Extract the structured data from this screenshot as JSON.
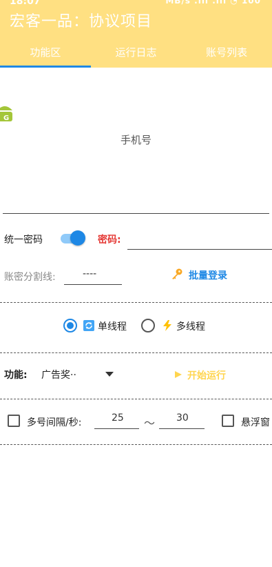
{
  "statusbar": {
    "time": "18:07",
    "icons": "MB/s  .ıll  .ıll  ◔ 100"
  },
  "app": {
    "title": "宏客一品：协议项目"
  },
  "tabs": [
    {
      "label": "功能区",
      "active": true
    },
    {
      "label": "运行日志",
      "active": false
    },
    {
      "label": "账号列表",
      "active": false
    }
  ],
  "phone": {
    "label": "手机号",
    "value": ""
  },
  "password_row": {
    "unify_label": "统一密码",
    "unify_enabled": true,
    "password_label": "密码:",
    "password_value": ""
  },
  "split_row": {
    "label": "账密分割线:",
    "value": "----",
    "batch_login_label": "批量登录"
  },
  "thread_mode": {
    "single_label": "单线程",
    "multi_label": "多线程",
    "selected": "single"
  },
  "function_row": {
    "label": "功能:",
    "selected": "广告奖··",
    "start_label": "开始运行"
  },
  "interval_row": {
    "label": "多号间隔/秒:",
    "min": "25",
    "separator": "～",
    "max": "30",
    "float_label": "悬浮窗"
  },
  "colors": {
    "appbar": "#ffe082",
    "accent": "#1e88e5",
    "password_label": "#e53935",
    "batch_login": "#1e88e5",
    "start": "#ffd54f"
  },
  "icons": [
    "android-icon",
    "key-icon",
    "refresh-icon",
    "lightning-icon",
    "dropdown-arrow-icon",
    "play-icon"
  ]
}
